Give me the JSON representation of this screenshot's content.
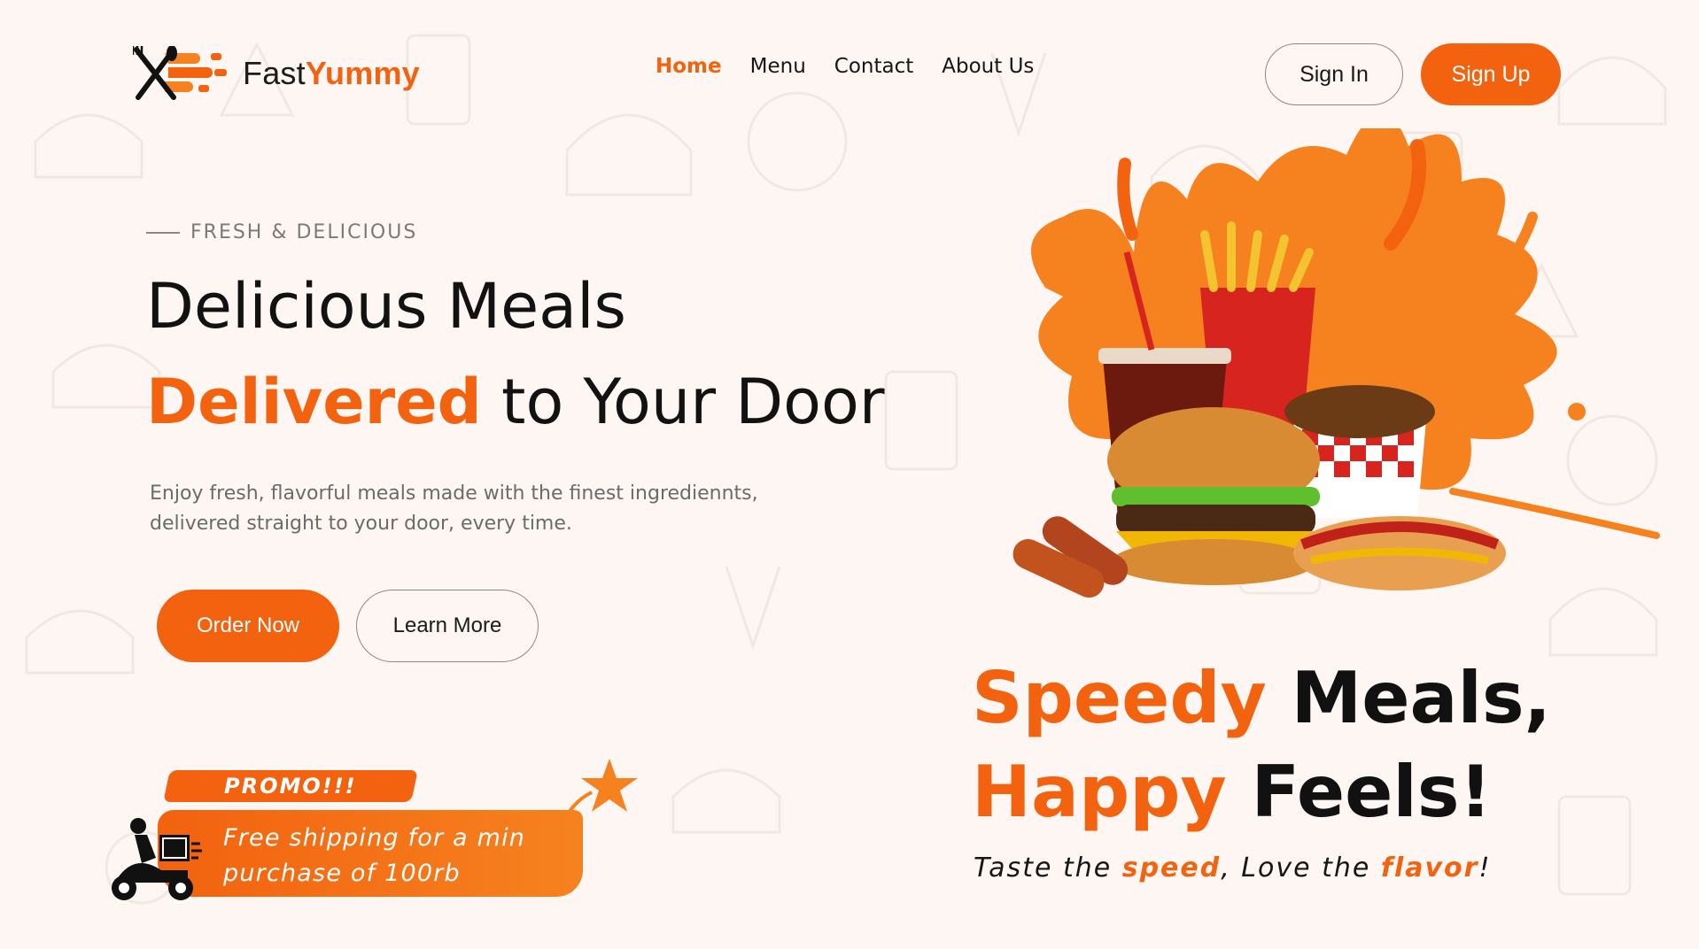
{
  "brand": {
    "fast": "Fast",
    "yummy": "Yummy"
  },
  "nav": [
    {
      "label": "Home",
      "active": true
    },
    {
      "label": "Menu",
      "active": false
    },
    {
      "label": "Contact",
      "active": false
    },
    {
      "label": "About Us",
      "active": false
    }
  ],
  "auth": {
    "signin": "Sign In",
    "signup": "Sign Up"
  },
  "hero": {
    "eyebrow": "FRESH & DELICIOUS",
    "line1": "Delicious Meals",
    "line2_accent": "Delivered",
    "line2_rest": " to Your Door",
    "description": "Enjoy fresh, flavorful meals made with the finest ingrediennts, delivered straight to your door, every time.",
    "order_label": "Order Now",
    "learn_label": "Learn More"
  },
  "promo": {
    "tag": "PROMO!!!",
    "text": "Free shipping for a min purchase of 100rb"
  },
  "tagline": {
    "line1_accent": "Speedy",
    "line1_rest": " Meals,",
    "line2_accent": "Happy",
    "line2_rest": " Feels!",
    "sub_1": "Taste the ",
    "sub_speed": "speed",
    "sub_2": ", Love the ",
    "sub_flavor": "flavor",
    "sub_3": "!"
  },
  "colors": {
    "accent": "#f2620f",
    "background": "#fdf6f3",
    "text": "#121212"
  },
  "icons": [
    "fork-knife-logo-icon",
    "scooter-delivery-icon",
    "star-icon",
    "food-combo-image"
  ]
}
